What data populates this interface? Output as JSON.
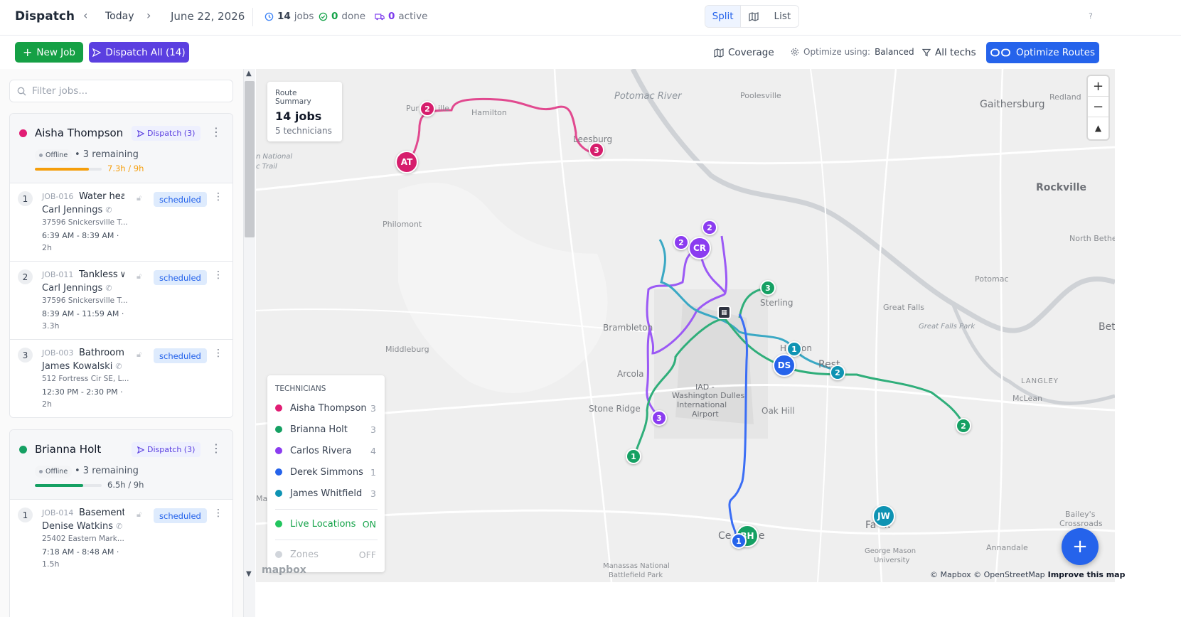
{
  "header": {
    "title": "Dispatch",
    "today": "Today",
    "date": "June 22, 2026",
    "stats": {
      "jobs_count": "14",
      "jobs_label": "jobs",
      "done_count": "0",
      "done_label": "done",
      "active_count": "0",
      "active_label": "active"
    },
    "views": {
      "split": "Split",
      "list": "List"
    },
    "help": "?"
  },
  "toolbar": {
    "new_job": "New Job",
    "dispatch_all": "Dispatch All (14)",
    "coverage": "Coverage",
    "optimize_label": "Optimize using:",
    "optimize_value": "Balanced",
    "all_techs": "All techs",
    "optimize_routes": "Optimize Routes"
  },
  "filter": {
    "placeholder": "Filter jobs..."
  },
  "technicians": [
    {
      "name": "Aisha Thompson",
      "color": "#e11d74",
      "dispatch": "Dispatch (3)",
      "status": "Offline",
      "remaining": "• 3 remaining",
      "hours": "7.3h / 9h",
      "hours_color": "#f59e0b",
      "progress": 0.81,
      "jobs": [
        {
          "num": "1",
          "id": "JOB-016",
          "title": "Water hea",
          "status": "scheduled",
          "customer": "Carl Jennings",
          "address": "37596 Snickersville T...",
          "time": "6:39 AM - 8:39 AM ·",
          "duration": "2h"
        },
        {
          "num": "2",
          "id": "JOB-011",
          "title": "Tankless wa",
          "status": "scheduled",
          "customer": "Carl Jennings",
          "address": "37596 Snickersville T...",
          "time": "8:39 AM - 11:59 AM ·",
          "duration": "3.3h"
        },
        {
          "num": "3",
          "id": "JOB-003",
          "title": "Bathroom",
          "status": "scheduled",
          "customer": "James Kowalski",
          "address": "512 Fortress Cir SE, L...",
          "time": "12:30 PM - 2:30 PM ·",
          "duration": "2h"
        }
      ]
    },
    {
      "name": "Brianna Holt",
      "color": "#15a063",
      "dispatch": "Dispatch (3)",
      "status": "Offline",
      "remaining": "• 3 remaining",
      "hours": "6.5h / 9h",
      "hours_color": "#4b5563",
      "progress": 0.72,
      "jobs": [
        {
          "num": "1",
          "id": "JOB-014",
          "title": "Basement",
          "status": "scheduled",
          "customer": "Denise Watkins",
          "address": "25402 Eastern Mark...",
          "time": "7:18 AM - 8:48 AM ·",
          "duration": "1.5h"
        }
      ]
    }
  ],
  "map": {
    "summary": {
      "label": "Route Summary",
      "jobs": "14 jobs",
      "techs": "5 technicians"
    },
    "legend": {
      "title": "TECHNICIANS",
      "items": [
        {
          "name": "Aisha Thompson",
          "count": "3",
          "color": "#e11d74"
        },
        {
          "name": "Brianna Holt",
          "count": "3",
          "color": "#15a063"
        },
        {
          "name": "Carlos Rivera",
          "count": "4",
          "color": "#8b3cf0"
        },
        {
          "name": "Derek Simmons",
          "count": "1",
          "color": "#2563eb"
        },
        {
          "name": "James Whitfield",
          "count": "3",
          "color": "#0e93b3"
        }
      ],
      "live_label": "Live Locations",
      "live_value": "ON",
      "zones_label": "Zones",
      "zones_value": "OFF"
    },
    "places": {
      "potomac": "Potomac River",
      "poolesville": "Poolesville",
      "gaithersburg": "Gaithersburg",
      "redland": "Redland",
      "rockville": "Rockville",
      "north_bethesda": "North Bethe",
      "potomac_town": "Potomac",
      "great_falls": "Great Falls",
      "great_falls_park": "Great Falls Park",
      "bet": "Bet",
      "langley": "LANGLEY",
      "mclean": "McLean",
      "hamilton": "Hamilton",
      "purcellville": "Pur",
      "purc_2": "ille",
      "leesburg": "Leesburg",
      "philomont": "Philomont",
      "natl": "n National",
      "trail": "c Trail",
      "middleburg": "Middleburg",
      "brambleton": "Brambleton",
      "sterling": "Sterling",
      "herndon": "H",
      "herndon_2": "on",
      "reston": "Rest",
      "arcola": "Arcola",
      "stone_ridge": "Stone Ridge",
      "oak_hill": "Oak Hill",
      "iad_1": "IAD -",
      "iad_2": "Washington Dulles",
      "iad_3": "International",
      "iad_4": "Airport",
      "centreville": "Ce",
      "centreville_2": "le",
      "fairfax": "Fa",
      "fairfax_2": "x",
      "george_mason_1": "George Mason",
      "george_mason_2": "University",
      "annandale": "Annandale",
      "baileys_1": "Bailey's",
      "baileys_2": "Crossroads",
      "manassas_1": "Manassas National",
      "manassas_2": "Battlefield Park",
      "mar": "Mar"
    },
    "markers": {
      "at": "AT",
      "cr": "CR",
      "ds": "DS",
      "jw": "JW",
      "bh": "BH",
      "s1": "1",
      "s2": "2",
      "s3": "3"
    },
    "zoom_in": "+",
    "zoom_out": "−",
    "compass": "▲",
    "fab": "+",
    "mapbox": "mapbox",
    "attribution": "© Mapbox © OpenStreetMap",
    "improve": "Improve this map"
  },
  "icons": {
    "clock": "clock-icon",
    "check": "check-circle-icon",
    "truck": "truck-icon",
    "search": "search-icon",
    "map": "map-icon",
    "gear": "gear-icon",
    "filter": "filter-icon",
    "send": "send-icon",
    "phone": "phone-icon",
    "lock": "lock-icon"
  }
}
